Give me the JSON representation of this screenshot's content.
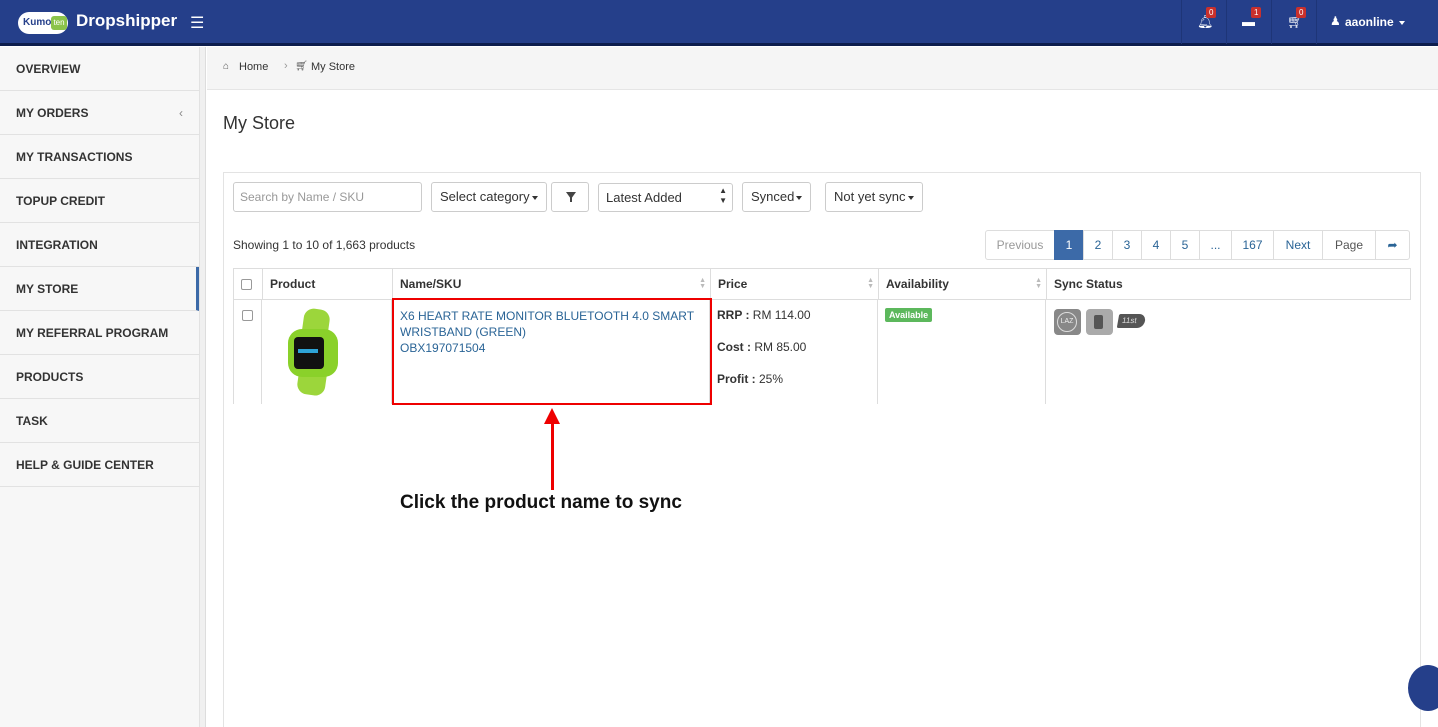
{
  "header": {
    "brand": "Dropshipper",
    "logo_text": "Kumo",
    "logo_badge": "ten",
    "notifications": {
      "icon": "bell-icon",
      "count": "0"
    },
    "messages": {
      "icon": "inbox-icon",
      "count": "1"
    },
    "cart": {
      "icon": "cart-icon",
      "count": "0"
    },
    "user": "aaonline",
    "colors": {
      "bar": "#253f8a",
      "badge": "#c9302c"
    }
  },
  "sidebar": {
    "items": [
      {
        "label": "OVERVIEW"
      },
      {
        "label": "MY ORDERS",
        "arrow": "‹"
      },
      {
        "label": "MY TRANSACTIONS"
      },
      {
        "label": "TOPUP CREDIT"
      },
      {
        "label": "INTEGRATION"
      },
      {
        "label": "MY STORE",
        "active": true
      },
      {
        "label": "MY REFERRAL PROGRAM"
      },
      {
        "label": "PRODUCTS"
      },
      {
        "label": "TASK"
      },
      {
        "label": "HELP & GUIDE CENTER"
      }
    ]
  },
  "breadcrumb": {
    "home": "Home",
    "current": "My Store"
  },
  "page_title": "My Store",
  "toolbar": {
    "search_placeholder": "Search by Name / SKU",
    "category": "Select category",
    "sort": "Latest Added",
    "synced": "Synced",
    "not_synced": "Not yet sync"
  },
  "showing": "Showing 1 to 10 of 1,663 products",
  "pagination": [
    "Previous",
    "1",
    "2",
    "3",
    "4",
    "5",
    "...",
    "167",
    "Next",
    "Page"
  ],
  "table": {
    "headers": [
      "Product",
      "Name/SKU",
      "Price",
      "Availability",
      "Sync Status"
    ],
    "rows": [
      {
        "name": "X6 HEART RATE MONITOR BLUETOOTH 4.0 SMART WRISTBAND (GREEN)",
        "sku": "OBX197071504",
        "rrp_label": "RRP :",
        "rrp": " RM 114.00",
        "cost_label": "Cost :",
        "cost": " RM 85.00",
        "profit_label": "Profit :",
        "profit": " 25%",
        "availability": "Available",
        "sync_icons": [
          "lazada-icon",
          "shopee-icon",
          "11street-icon"
        ],
        "laz_text": "LAZ",
        "street_text": "11st"
      }
    ]
  },
  "annotation": "Click the product name to sync"
}
